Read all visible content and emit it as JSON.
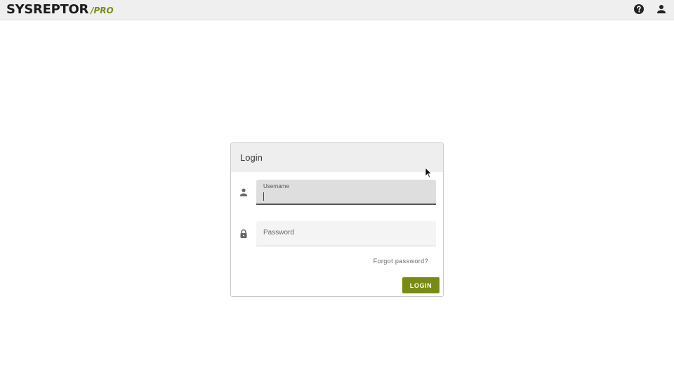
{
  "header": {
    "logo_text": "SYSREPTOR",
    "logo_suffix": "/PRO",
    "icons": [
      "help-icon",
      "account-icon"
    ]
  },
  "login": {
    "title": "Login",
    "username": {
      "label": "Username",
      "value": ""
    },
    "password": {
      "placeholder": "Password",
      "value": ""
    },
    "forgot_label": "Forgot password?",
    "submit_label": "LOGIN"
  },
  "colors": {
    "accent": "#7a8b14",
    "topbar_bg": "#efefef",
    "card_header_bg": "#eeeeee"
  }
}
